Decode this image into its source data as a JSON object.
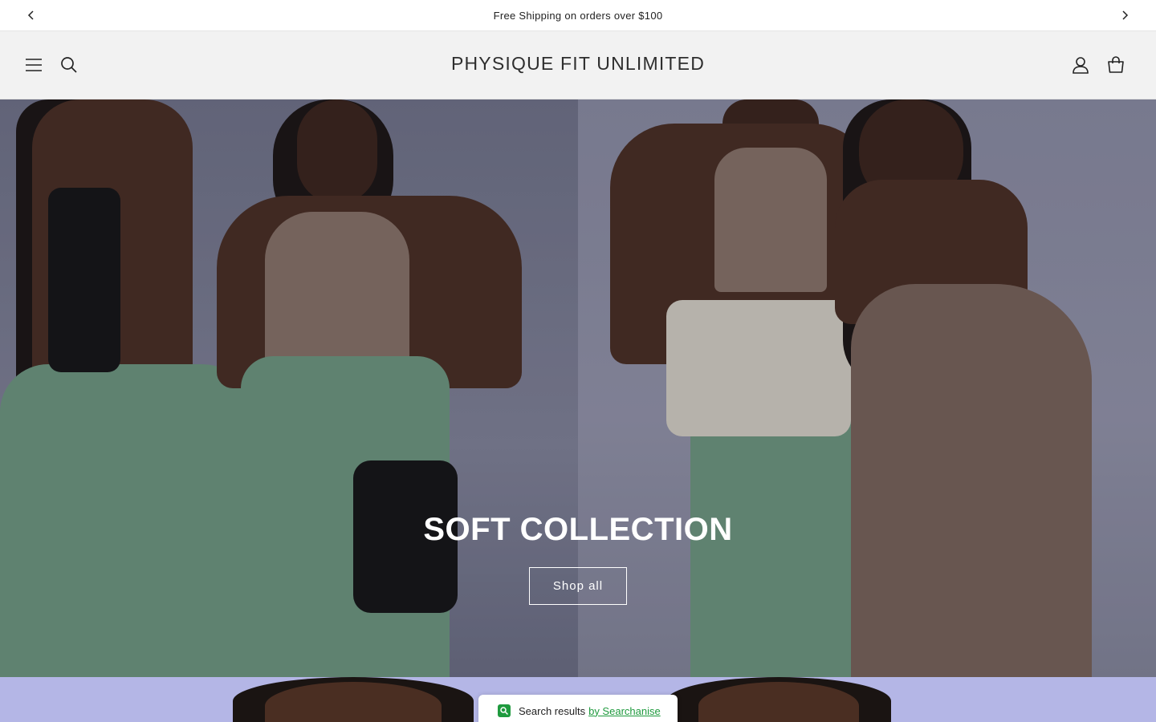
{
  "announcement": {
    "text": "Free Shipping on orders over $100",
    "prev_icon": "chevron-left-icon",
    "next_icon": "chevron-right-icon"
  },
  "header": {
    "brand": "PHYSIQUE FIT UNLIMITED",
    "left_icons": [
      "menu-icon",
      "search-icon"
    ],
    "right_icons": [
      "account-icon",
      "cart-icon"
    ]
  },
  "hero": {
    "title": "SOFT COLLECTION",
    "button_label": "Shop all"
  },
  "searchanise": {
    "text": "Search results",
    "link": "by Searchanise",
    "accent": "#1f9a3e"
  }
}
